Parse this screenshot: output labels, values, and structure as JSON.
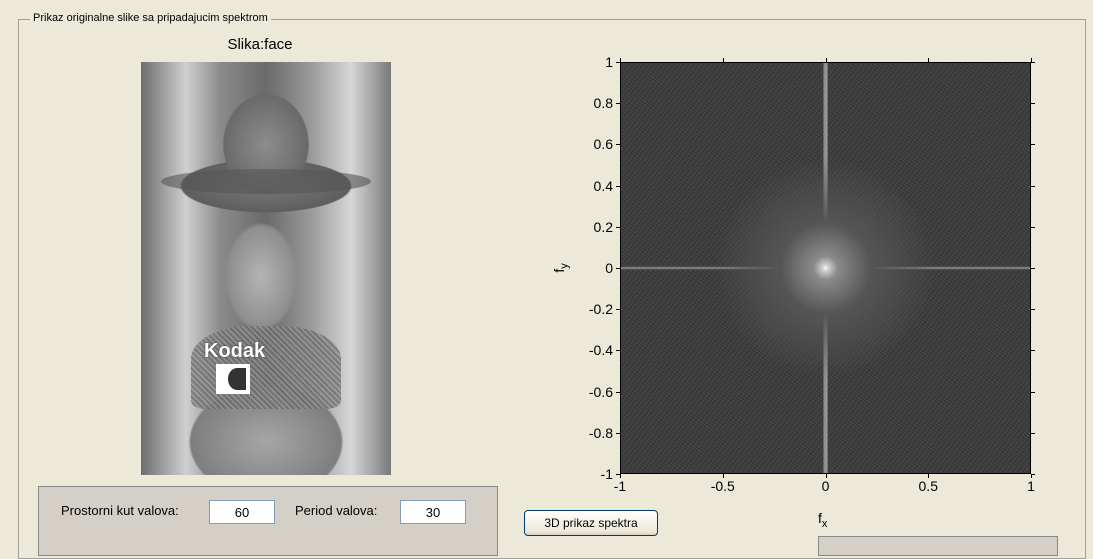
{
  "group": {
    "title": "Prikaz originalne slike sa pripadajucim spektrom"
  },
  "image": {
    "title": "Slika:face",
    "logo_text": "Kodak"
  },
  "spectrum": {
    "y_ticks": [
      "1",
      "0.8",
      "0.6",
      "0.4",
      "0.2",
      "0",
      "-0.2",
      "-0.4",
      "-0.6",
      "-0.8",
      "-1"
    ],
    "x_ticks": [
      "-1",
      "-0.5",
      "0",
      "0.5",
      "1"
    ],
    "ylabel": "f",
    "ylabel_sub": "y",
    "xlabel": "f",
    "xlabel_sub": "x",
    "xlim": [
      -1,
      1
    ],
    "ylim": [
      -1,
      1
    ]
  },
  "controls": {
    "angle_label": "Prostorni kut valova:",
    "angle_value": "60",
    "period_label": "Period valova:",
    "period_value": "30",
    "button_3d": "3D prikaz spektra"
  }
}
